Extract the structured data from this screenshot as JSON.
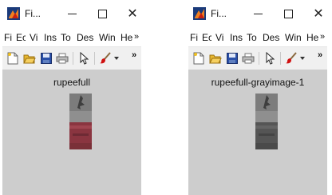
{
  "windows": [
    {
      "title": "Fi...",
      "menu": [
        "Fi",
        "Ec",
        "Vi",
        "Ins",
        "To",
        "Des",
        "Win",
        "He"
      ],
      "menu_overflow": "»",
      "toolbar_overflow": "»",
      "axes_title": "rupeefull",
      "image_mode": "color",
      "colors": {
        "accent_pen": "#d01010",
        "image_band": "#8a3540"
      }
    },
    {
      "title": "Fi...",
      "menu": [
        "Fi",
        "Ec",
        "Vi",
        "Ins",
        "To",
        "Des",
        "Win",
        "He"
      ],
      "menu_overflow": "»",
      "toolbar_overflow": "»",
      "axes_title": "rupeefull-grayimage-1",
      "image_mode": "grayscale",
      "colors": {
        "accent_pen": "#d01010",
        "image_band": "#555555"
      }
    }
  ],
  "icons": {
    "app": "matlab-figure-icon",
    "minimize": "minimize-icon",
    "maximize": "maximize-icon",
    "close": "close-icon",
    "toolbar": [
      "new-figure-icon",
      "open-file-icon",
      "save-icon",
      "print-icon",
      "pointer-icon",
      "brush-icon",
      "dropdown-arrow-icon"
    ]
  }
}
